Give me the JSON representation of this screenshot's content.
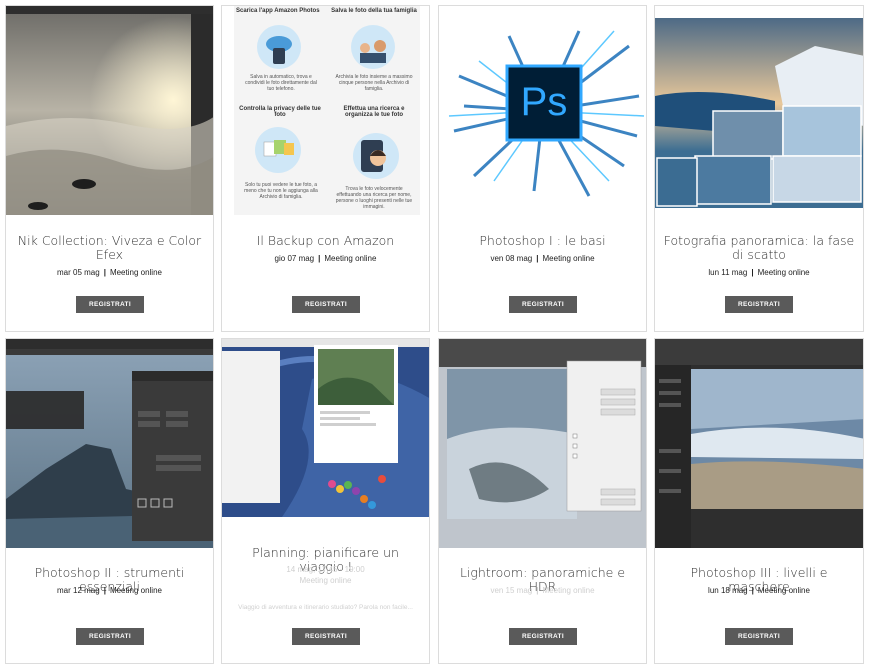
{
  "register_label": "REGISTRATI",
  "cards": [
    {
      "title": "Nik Collection: Viveza e Color Efex",
      "date": "mar 05 mag",
      "location": "Meeting online"
    },
    {
      "title": "Il Backup con Amazon",
      "date": "gio 07 mag",
      "location": "Meeting online",
      "image_text": {
        "h1": "Scarica l'app Amazon Photos",
        "p1": "Salva in automatico, trova e condividi le foto direttamente dal tuo telefono.",
        "h2": "Salva le foto della tua famiglia",
        "p2": "Archivia le foto insieme a massimo cinque persone nella Archivio di famiglia.",
        "h3": "Controlla la privacy delle tue foto",
        "p3": "Solo tu puoi vedere le tue foto, a meno che tu non le aggiunga alla Archivio di famiglia.",
        "h4": "Effettua una ricerca e organizza le tue foto",
        "p4": "Trova le foto velocemente effettuando una ricerca per nome, persone o luoghi presenti nelle tue immagini."
      }
    },
    {
      "title": "Photoshop I : le basi",
      "date": "ven 08 mag",
      "location": "Meeting online",
      "logo_text": "Ps"
    },
    {
      "title": "Fotografia panoramica: la fase di scatto",
      "date": "lun 11 mag",
      "location": "Meeting online"
    },
    {
      "title": "Photoshop II : strumenti essenziali",
      "date": "mar 12 mag",
      "location": "Meeting online"
    },
    {
      "title": "Planning: pianificare un viaggio I",
      "date": "14 mag, 17:45 - 19:00",
      "location": "Meeting online",
      "description": "Viaggio di avventura e itinerario studiato? Parola non facile..."
    },
    {
      "title": "Lightroom: panoramiche e HDR",
      "date": "ven 15 mag",
      "location": "Meeting online"
    },
    {
      "title": "Photoshop III : livelli e maschere",
      "date": "lun 18 mag",
      "location": "Meeting online"
    }
  ],
  "colors": {
    "button_bg": "#5a5a5a",
    "card_border": "#dcdcdc",
    "ps_blue": "#31a8ff",
    "ps_dark": "#001e36"
  }
}
